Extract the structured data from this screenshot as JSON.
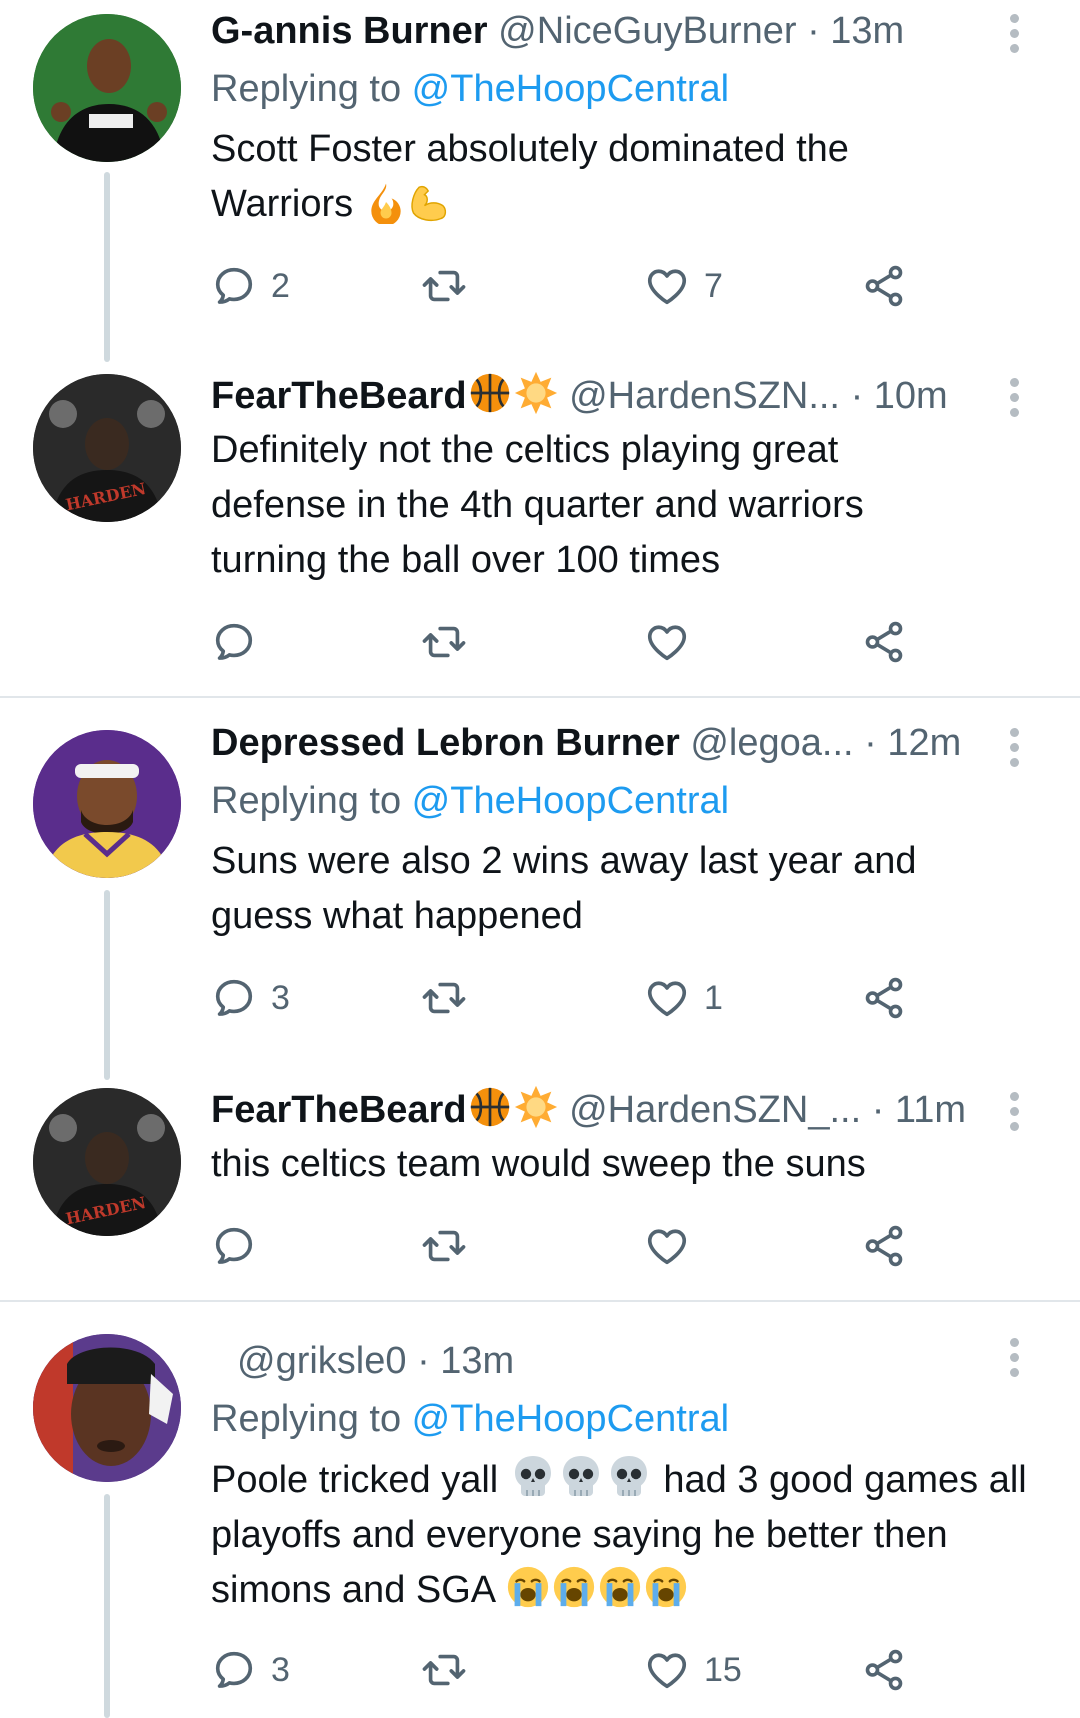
{
  "tweets": [
    {
      "name": "G-annis Burner",
      "handle": "@NiceGuyBurner",
      "time": "· 13m",
      "replying_prefix": "Replying to ",
      "replying_to": "@TheHoopCentral",
      "text": "Scott Foster absolutely dominated the Warriors",
      "emojis": [
        "fire-emoji",
        "flexed-biceps-emoji"
      ],
      "reply_count": "2",
      "retweet_count": "",
      "like_count": "7"
    },
    {
      "name": "FearTheBeard",
      "name_emojis": [
        "basketball-emoji",
        "sun-emoji"
      ],
      "handle": "@HardenSZN...",
      "time": "· 10m",
      "text": "Definitely not the celtics playing great defense in the 4th quarter and warriors turning the ball over 100 times",
      "reply_count": "",
      "retweet_count": "",
      "like_count": ""
    },
    {
      "name": "Depressed Lebron Burner",
      "handle": "@legoa...",
      "time": "· 12m",
      "replying_prefix": "Replying to ",
      "replying_to": "@TheHoopCentral",
      "text": "Suns were also 2 wins away last year and guess what happened",
      "reply_count": "3",
      "retweet_count": "",
      "like_count": "1"
    },
    {
      "name": "FearTheBeard",
      "name_emojis": [
        "basketball-emoji",
        "sun-emoji"
      ],
      "handle": "@HardenSZN_...",
      "time": "· 11m",
      "text": "this celtics team would sweep the suns",
      "reply_count": "",
      "retweet_count": "",
      "like_count": ""
    },
    {
      "name": "",
      "handle": "@griksle0",
      "time": "· 13m",
      "replying_prefix": "Replying to ",
      "replying_to": "@TheHoopCentral",
      "text_part1": "Poole tricked yall",
      "text_part2": "had 3 good games all playoffs and everyone saying he better then simons and SGA",
      "emojis_1": [
        "skull-emoji",
        "skull-emoji",
        "skull-emoji"
      ],
      "emojis_2": [
        "crying-emoji",
        "crying-emoji",
        "crying-emoji",
        "crying-emoji"
      ],
      "reply_count": "3",
      "retweet_count": "",
      "like_count": "15"
    }
  ],
  "colors": {
    "link": "#1d9bf0",
    "secondary_text": "#536471",
    "thread_line": "#cfd9de",
    "divider": "#e1e6ea"
  }
}
